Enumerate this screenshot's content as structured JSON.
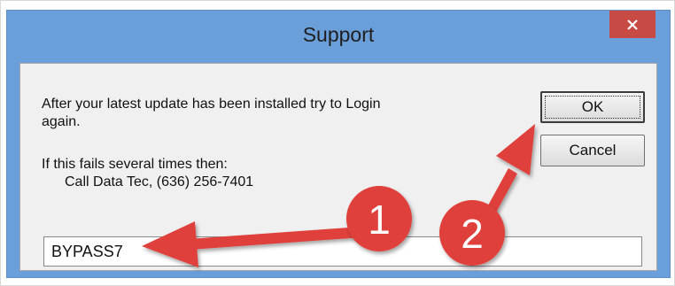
{
  "window": {
    "title": "Support",
    "close_glyph": "×"
  },
  "message": {
    "line1": "After your latest update has been installed try to Login",
    "line2": "again.",
    "line3": "If this fails several times then:",
    "line4": "Call Data Tec, (636) 256-7401"
  },
  "buttons": {
    "ok_label": "OK",
    "cancel_label": "Cancel"
  },
  "bypass_input": {
    "value": "BYPASS7"
  },
  "annotations": [
    {
      "label": "1",
      "color": "#e0413a"
    },
    {
      "label": "2",
      "color": "#e0413a"
    }
  ]
}
